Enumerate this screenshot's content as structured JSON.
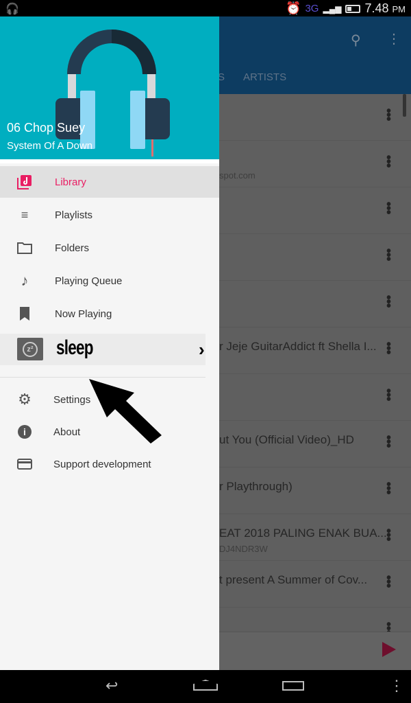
{
  "status_bar": {
    "network": "3G",
    "time": "7.48",
    "ampm": "PM"
  },
  "toolbar": {
    "tab_partial": "S",
    "tab_artists": "ARTISTS"
  },
  "drawer": {
    "song_title": "06 Chop Suey",
    "artist": "System Of A Down",
    "items": [
      {
        "label": "Library",
        "icon": "library-music-icon",
        "active": true
      },
      {
        "label": "Playlists",
        "icon": "playlist-icon"
      },
      {
        "label": "Folders",
        "icon": "folder-icon"
      },
      {
        "label": "Playing Queue",
        "icon": "music-note-icon"
      },
      {
        "label": "Now Playing",
        "icon": "bookmark-music-icon"
      }
    ],
    "sleep": {
      "label": "sleep"
    },
    "secondary": [
      {
        "label": "Settings",
        "icon": "gear-icon"
      },
      {
        "label": "About",
        "icon": "info-icon"
      },
      {
        "label": "Support development",
        "icon": "credit-card-icon"
      }
    ]
  },
  "songs": [
    {
      "title": "",
      "subtitle": ""
    },
    {
      "title": "",
      "subtitle": "spot.com"
    },
    {
      "title": "",
      "subtitle": ""
    },
    {
      "title": "",
      "subtitle": ""
    },
    {
      "title": "",
      "subtitle": ""
    },
    {
      "title": "r Jeje GuitarAddict ft Shella I...",
      "subtitle": ""
    },
    {
      "title": "",
      "subtitle": ""
    },
    {
      "title": "ut You (Official Video)_HD",
      "subtitle": ""
    },
    {
      "title": "r Playthrough)",
      "subtitle": ""
    },
    {
      "title": "EAT 2018 PALING ENAK BUA...",
      "subtitle": "DJ4NDR3W"
    },
    {
      "title": "t present A Summer of Cov...",
      "subtitle": ""
    },
    {
      "title": "",
      "subtitle": ""
    }
  ],
  "colors": {
    "accent": "#e91e63",
    "header": "#00aec0",
    "toolbar": "#0d3c61"
  }
}
